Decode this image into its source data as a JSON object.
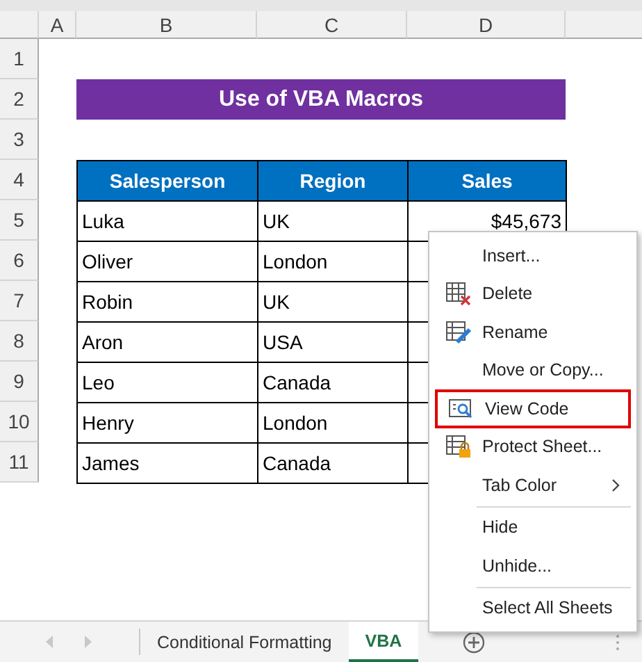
{
  "column_headers": [
    "A",
    "B",
    "C",
    "D"
  ],
  "row_headers": [
    "1",
    "2",
    "3",
    "4",
    "5",
    "6",
    "7",
    "8",
    "9",
    "10",
    "11"
  ],
  "title": "Use of VBA Macros",
  "table": {
    "columns": [
      "Salesperson",
      "Region",
      "Sales"
    ],
    "rows": [
      {
        "salesperson": "Luka",
        "region": "UK",
        "sales": "$45,673"
      },
      {
        "salesperson": "Oliver",
        "region": "London"
      },
      {
        "salesperson": "Robin",
        "region": "UK"
      },
      {
        "salesperson": "Aron",
        "region": "USA"
      },
      {
        "salesperson": "Leo",
        "region": "Canada"
      },
      {
        "salesperson": "Henry",
        "region": "London"
      },
      {
        "salesperson": "James",
        "region": "Canada"
      }
    ]
  },
  "context_menu": {
    "items": [
      {
        "kind": "plain",
        "label": "Insert...",
        "highlighted": false
      },
      {
        "kind": "delete",
        "label": "Delete",
        "highlighted": false
      },
      {
        "kind": "rename",
        "label": "Rename",
        "highlighted": false
      },
      {
        "kind": "plain",
        "label": "Move or Copy...",
        "highlighted": false
      },
      {
        "kind": "view",
        "label": "View Code",
        "highlighted": true
      },
      {
        "kind": "protect",
        "label": "Protect Sheet...",
        "highlighted": false
      },
      {
        "kind": "submenu",
        "label": "Tab Color",
        "highlighted": false
      },
      {
        "kind": "separator"
      },
      {
        "kind": "plain",
        "label": "Hide",
        "highlighted": false
      },
      {
        "kind": "plain",
        "label": "Unhide...",
        "highlighted": false
      },
      {
        "kind": "separator"
      },
      {
        "kind": "plain",
        "label": "Select All Sheets",
        "highlighted": false
      }
    ]
  },
  "sheet_tabs": [
    {
      "label": "Conditional Formatting",
      "selected": false
    },
    {
      "label": "VBA",
      "selected": true
    }
  ]
}
